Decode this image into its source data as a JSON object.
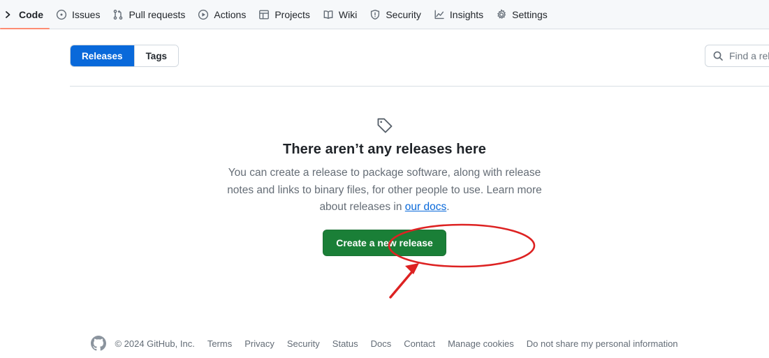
{
  "repo_nav": {
    "items": [
      {
        "label": "Code",
        "icon": "code-chevron-icon",
        "active": true
      },
      {
        "label": "Issues",
        "icon": "issue-opened-icon",
        "active": false
      },
      {
        "label": "Pull requests",
        "icon": "git-pull-request-icon",
        "active": false
      },
      {
        "label": "Actions",
        "icon": "play-icon",
        "active": false
      },
      {
        "label": "Projects",
        "icon": "table-icon",
        "active": false
      },
      {
        "label": "Wiki",
        "icon": "book-icon",
        "active": false
      },
      {
        "label": "Security",
        "icon": "shield-icon",
        "active": false
      },
      {
        "label": "Insights",
        "icon": "graph-icon",
        "active": false
      },
      {
        "label": "Settings",
        "icon": "gear-icon",
        "active": false
      }
    ],
    "active_underline_color": "#fd8c73",
    "background_color": "#f6f8fa"
  },
  "toolbar": {
    "releases_tab": "Releases",
    "tags_tab": "Tags",
    "selected_tab": "Releases",
    "selected_tab_color": "#0969da",
    "search": {
      "placeholder": "Find a release",
      "value": "",
      "icon": "search-icon"
    }
  },
  "blankslate": {
    "icon": "tag-icon",
    "title": "There aren’t any releases here",
    "body_part1": "You can create a release to package software, along with release notes and links to binary files, for other people to use. Learn more about releases in ",
    "link_text": "our docs",
    "body_part2": ".",
    "cta_label": "Create a new release",
    "cta_color": "#1a7f37"
  },
  "annotation": {
    "highlight_color": "#dd2222",
    "shapes": [
      "ellipse-around-create-release-button",
      "arrow-pointing-to-create-release-button"
    ]
  },
  "footer": {
    "logo": "github-mark-icon",
    "copyright": "© 2024 GitHub, Inc.",
    "links": [
      "Terms",
      "Privacy",
      "Security",
      "Status",
      "Docs",
      "Contact",
      "Manage cookies",
      "Do not share my personal information"
    ]
  }
}
